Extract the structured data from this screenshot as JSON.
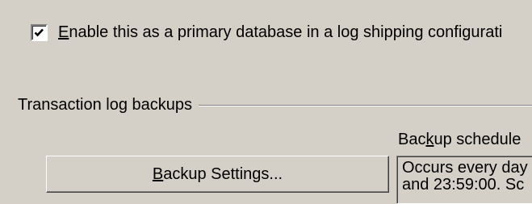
{
  "primary_database": {
    "checked": true,
    "label_prefix": "",
    "label_mnemonic": "E",
    "label_rest": "nable this as a primary database in a log shipping configurati"
  },
  "transaction_log_backups": {
    "group_title": "Transaction log backups",
    "schedule_label_pre": "Bac",
    "schedule_label_mnemonic": "k",
    "schedule_label_post": "up schedule",
    "backup_settings_button_mnemonic": "B",
    "backup_settings_button_rest": "ackup Settings...",
    "schedule_line1": "Occurs every day",
    "schedule_line2": "and 23:59:00. Sc"
  },
  "icons": {
    "checkbox_mark": "checkmark-icon"
  },
  "colors": {
    "background": "#d4d0c8",
    "shadow": "#808080",
    "highlight": "#ffffff"
  }
}
